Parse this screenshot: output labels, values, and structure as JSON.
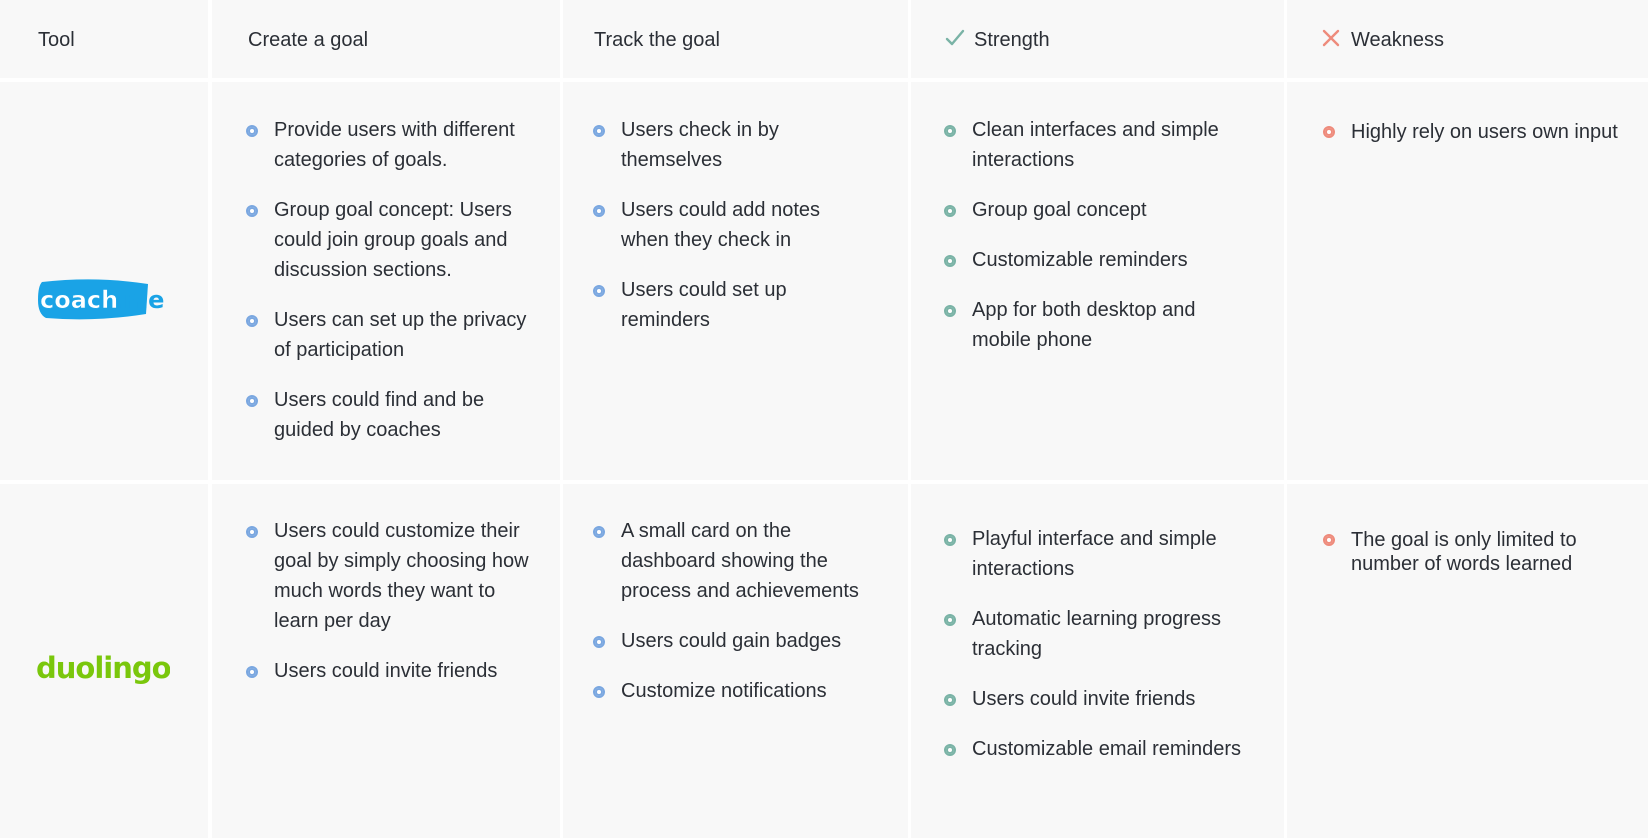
{
  "header": {
    "tool": "Tool",
    "create_goal": "Create a goal",
    "track_goal": "Track the goal",
    "strength": "Strength",
    "weakness": "Weakness"
  },
  "icons": {
    "strength": "check-icon",
    "weakness": "x-icon"
  },
  "colors": {
    "bullet_create_track": "#7aa7e0",
    "bullet_strength": "#7ab3a6",
    "bullet_weakness": "#ee8b7c",
    "coachme_logo": "#1aa3e6",
    "duolingo_logo": "#7ac70c"
  },
  "rows": [
    {
      "tool_logo": "coach.me",
      "create_goal": [
        "Provide users with different categories of goals.",
        "Group goal concept: Users could join group goals and discussion sections.",
        "Users can set up the privacy of participation",
        "Users could find and be guided by coaches"
      ],
      "track_goal": [
        "Users check in by themselves",
        "Users could add notes when they check in",
        "Users could set up reminders"
      ],
      "strength": [
        "Clean interfaces and simple interactions",
        "Group goal concept",
        "Customizable reminders",
        "App for both desktop and mobile phone"
      ],
      "weakness": [
        "Highly rely on users own input"
      ]
    },
    {
      "tool_logo": "duolingo",
      "create_goal": [
        "Users could customize their goal by simply choosing how much words they want to learn per day",
        "Users could invite friends"
      ],
      "track_goal": [
        "A small card on the dashboard showing the process and achievements",
        "Users could gain badges",
        "Customize notifications"
      ],
      "strength": [
        "Playful interface and simple interactions",
        "Automatic learning progress tracking",
        "Users could invite friends",
        "Customizable email reminders"
      ],
      "weakness": [
        "The goal is only limited to number of words learned"
      ]
    }
  ]
}
